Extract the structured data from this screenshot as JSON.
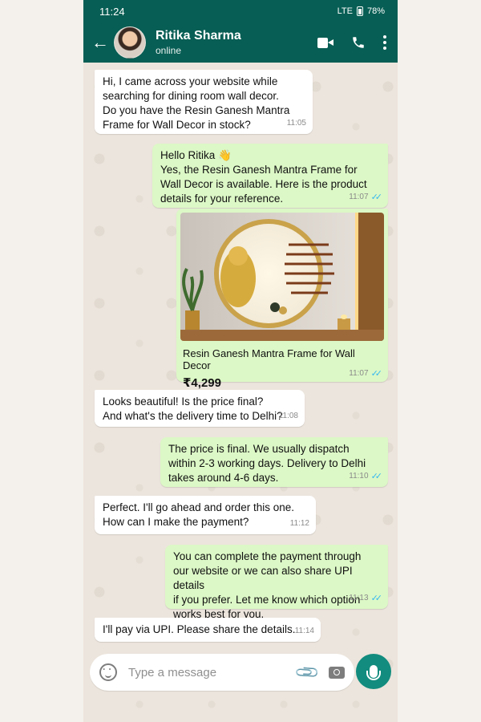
{
  "status_bar": {
    "time": "11:24",
    "signal": "LTE",
    "battery": "78%"
  },
  "header": {
    "back_icon": "←",
    "name": "Ritika Sharma",
    "status": "online"
  },
  "messages": [
    {
      "dir": "in",
      "text": "Hi, I came across your website while\nsearching for dining room wall decor.\nDo you have the Resin Ganesh Mantra\nFrame for Wall Decor in stock?",
      "time": "11:05"
    },
    {
      "dir": "out",
      "text": "Hello Ritika 👋\nYes, the Resin Ganesh Mantra Frame for\nWall Decor is available. Here is the product\ndetails for your reference.",
      "time": "11:07",
      "ticks": "✓✓"
    },
    {
      "dir": "in",
      "text": "Looks beautiful! Is the price final?\nAnd what's the delivery time to Delhi?",
      "time": "11:08"
    },
    {
      "dir": "out",
      "text": "The price is final. We usually dispatch\nwithin 2-3 working days. Delivery to Delhi\ntakes around 4-6 days.",
      "time": "11:10",
      "ticks": "✓✓"
    },
    {
      "dir": "in",
      "text": "Perfect. I'll go ahead and order this one.\nHow can I make the payment?",
      "time": "11:12"
    },
    {
      "dir": "out",
      "text": "You can complete the payment through\nour website or we can also share UPI details\nif you prefer. Let me know which option\nworks best for you.",
      "time": "11:13",
      "ticks": "✓✓"
    },
    {
      "dir": "in",
      "text": "I'll pay via UPI. Please share the details.",
      "time": "11:14"
    }
  ],
  "product": {
    "title": "Resin Ganesh Mantra Frame for Wall Decor",
    "price": "₹4,299",
    "time": "11:07",
    "ticks": "✓✓"
  },
  "composer": {
    "placeholder": "Type a message"
  },
  "colors": {
    "header": "#075e54",
    "outgoing": "#dcf8c6",
    "incoming": "#ffffff",
    "mic": "#128c7e"
  }
}
